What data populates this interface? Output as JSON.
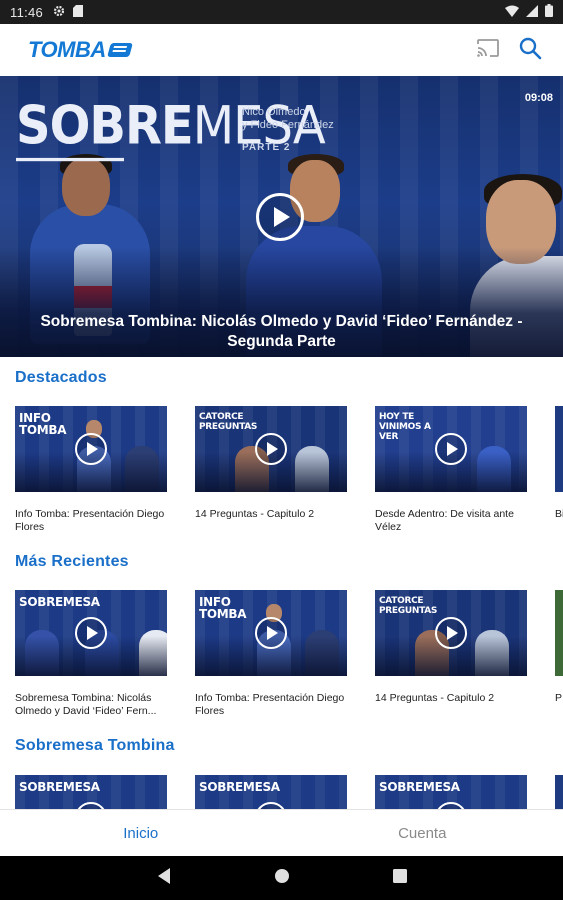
{
  "status_bar": {
    "time": "11:46"
  },
  "app": {
    "logo_text": "TOMBA"
  },
  "hero": {
    "duration": "09:08",
    "art_title_bold": "SOBRE",
    "art_title_light": "MESA",
    "art_subtitle_line1": "Nico Olmedo",
    "art_subtitle_line2": "y Fideo Fernández",
    "art_part": "PARTE 2",
    "caption": "Sobremesa Tombina: Nicolás Olmedo y David ‘Fideo’ Fernández - Segunda Parte"
  },
  "sections": [
    {
      "title": "Destacados",
      "cards": [
        {
          "label": "Info Tomba: Presentación Diego Flores",
          "thumb_logo": "INFO TOMBA"
        },
        {
          "label": "14 Preguntas - Capitulo 2",
          "thumb_logo": "CATORCE PREGUNTAS"
        },
        {
          "label": "Desde Adentro: De visita ante Vélez",
          "thumb_logo": "HOY TE VINIMOS A VER"
        },
        {
          "label": "Bi",
          "thumb_logo": ""
        }
      ]
    },
    {
      "title": "Más Recientes",
      "cards": [
        {
          "label": "Sobremesa Tombina: Nicolás Olmedo y David ‘Fideo’ Fern...",
          "thumb_logo": "SOBREMESA"
        },
        {
          "label": "Info Tomba: Presentación Diego Flores",
          "thumb_logo": "INFO TOMBA"
        },
        {
          "label": "14 Preguntas - Capitulo 2",
          "thumb_logo": "CATORCE PREGUNTAS"
        },
        {
          "label": "P d",
          "thumb_logo": ""
        }
      ]
    },
    {
      "title": "Sobremesa Tombina",
      "cards": [
        {
          "label": "",
          "thumb_logo": "SOBREMESA"
        },
        {
          "label": "",
          "thumb_logo": "SOBREMESA"
        },
        {
          "label": "",
          "thumb_logo": "SOBREMESA"
        },
        {
          "label": "",
          "thumb_logo": ""
        }
      ]
    }
  ],
  "bottom_nav": {
    "home_label": "Inicio",
    "account_label": "Cuenta"
  },
  "colors": {
    "accent": "#1a6fc9",
    "hero_bg": "#1c3d8a",
    "status_bar": "#1d1d1d",
    "inactive_nav": "#8a8a8a"
  },
  "icons": [
    "cast-icon",
    "search-icon",
    "play-icon",
    "back-icon",
    "home-icon",
    "recents-icon",
    "settings-icon",
    "sd-card-icon",
    "wifi-icon",
    "signal-icon",
    "battery-icon"
  ]
}
